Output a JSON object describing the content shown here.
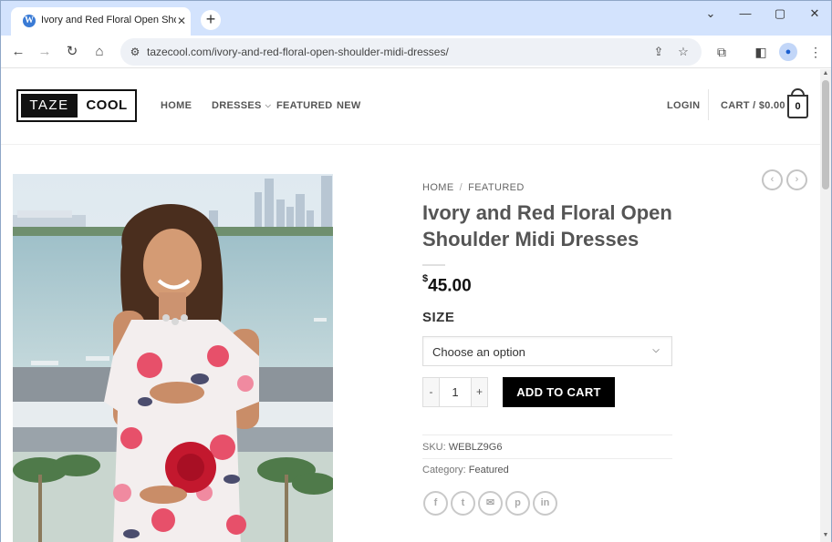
{
  "browser": {
    "tab_title": "Ivory and Red Floral Open Shou",
    "tab_favicon": "W",
    "url": "tazecool.com/ivory-and-red-floral-open-shoulder-midi-dresses/",
    "profile_initial": "●"
  },
  "site": {
    "logo_left": "TAZE",
    "logo_right": "COOL",
    "nav": [
      "HOME",
      "DRESSES",
      "FEATURED",
      "NEW"
    ],
    "login": "LOGIN",
    "cart_label": "CART / $0.00",
    "cart_count": "0"
  },
  "product": {
    "breadcrumb_home": "HOME",
    "breadcrumb_separator": "/",
    "breadcrumb_current": "FEATURED",
    "title": "Ivory and Red Floral Open Shoulder Midi Dresses",
    "price_symbol": "$",
    "price_value": "45.00",
    "size_label": "SIZE",
    "size_select": "Choose an option",
    "quantity": "1",
    "qty_minus": "-",
    "qty_plus": "+",
    "add_to_cart": "ADD TO CART",
    "sku_label": "SKU:",
    "sku_value": "WEBLZ9G6",
    "category_label": "Category:",
    "category_value": "Featured"
  },
  "icons": {
    "share": [
      "facebook-icon",
      "twitter-icon",
      "email-icon",
      "pinterest-icon",
      "linkedin-icon"
    ]
  },
  "colors": {
    "tabstrip": "#d3e3fd",
    "button": "#000000",
    "heading": "#555555"
  }
}
